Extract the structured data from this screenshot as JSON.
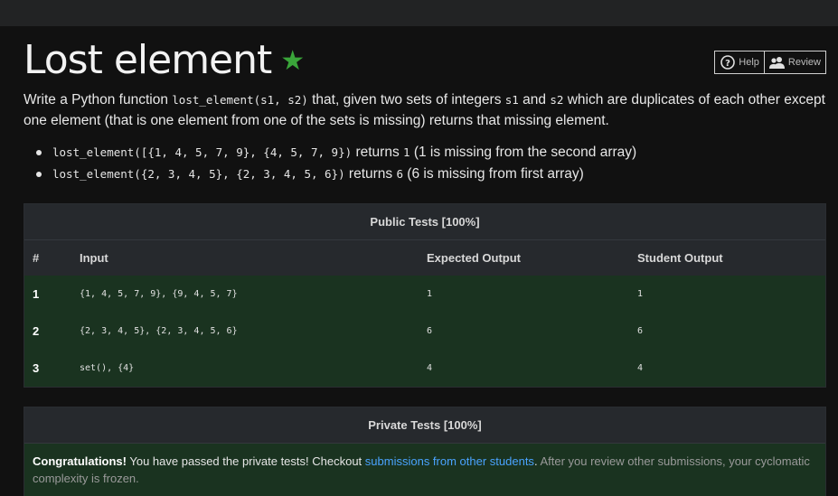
{
  "page": {
    "title": "Lost element",
    "star_icon": "star-icon",
    "accent_star": "#3aa53a"
  },
  "header_buttons": {
    "help_label": "Help",
    "review_label": "Review"
  },
  "description": {
    "text_1": "Write a Python function ",
    "code_signature": "lost_element(s1, s2)",
    "text_2": " that, given two sets of integers ",
    "code_s1": "s1",
    "text_3": " and ",
    "code_s2": "s2",
    "text_4": " which are duplicates of each other except one element (that is one element from one of the sets is missing) returns that missing element."
  },
  "examples": [
    {
      "code": "lost_element([{1, 4, 5, 7, 9}, {4, 5, 7, 9})",
      "returns": " returns ",
      "value": "1",
      "note": " (1 is missing from the second array)"
    },
    {
      "code": "lost_element({2, 3, 4, 5}, {2, 3, 4, 5, 6})",
      "returns": " returns ",
      "value": "6",
      "note": " (6 is missing from first array)"
    }
  ],
  "public_tests": {
    "heading": "Public Tests [100%]",
    "columns": [
      "#",
      "Input",
      "Expected Output",
      "Student Output"
    ],
    "rows": [
      {
        "num": "1",
        "input": "{1, 4, 5, 7, 9}, {9, 4, 5, 7}",
        "expected": "1",
        "student": "1"
      },
      {
        "num": "2",
        "input": "{2, 3, 4, 5}, {2, 3, 4, 5, 6}",
        "expected": "6",
        "student": "6"
      },
      {
        "num": "3",
        "input": "set(), {4}",
        "expected": "4",
        "student": "4"
      }
    ],
    "pass_color": "#1a3320"
  },
  "private_tests": {
    "heading": "Private Tests [100%]",
    "congrats": "Congratulations!",
    "text_1": " You have passed the private tests! Checkout ",
    "link_text": "submissions from other students",
    "text_2": ".",
    "muted_text": " After you review other submissions, your cyclomatic complexity is frozen."
  }
}
